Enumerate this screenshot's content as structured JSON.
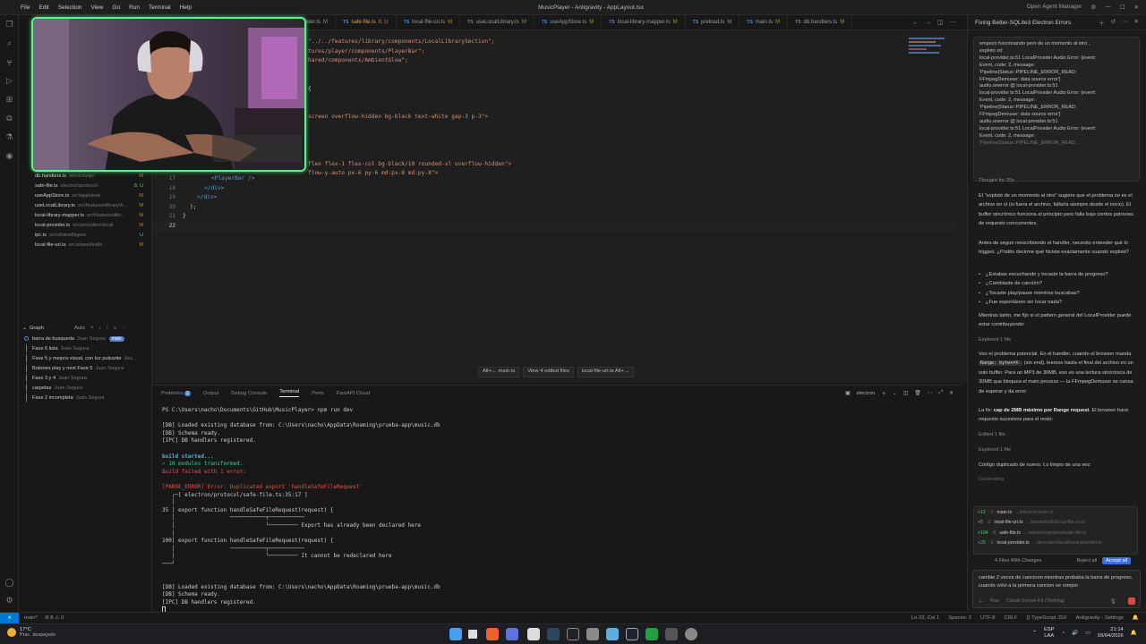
{
  "titlebar": {
    "menu": [
      "File",
      "Edit",
      "Selection",
      "View",
      "Go",
      "Run",
      "Terminal",
      "Help"
    ],
    "title": "MusicPlayer - Antigravity - AppLayout.tsx",
    "agent_manager": "Open Agent Manager"
  },
  "tabs": [
    {
      "label": "ider.ts",
      "mark": "M"
    },
    {
      "label": "safe-file.ts",
      "mark": "8, U"
    },
    {
      "label": "local-file-uri.ts",
      "mark": "M"
    },
    {
      "label": "useLocalLibrary.ts",
      "mark": "M"
    },
    {
      "label": "useAppStore.ts",
      "mark": "M"
    },
    {
      "label": "local-library-mapper.ts",
      "mark": "M"
    },
    {
      "label": "preload.ts",
      "mark": "M"
    },
    {
      "label": "main.ts",
      "mark": "M"
    },
    {
      "label": "db.handlers.ts",
      "mark": "M"
    }
  ],
  "editor": {
    "top_lines": [
      "\"../../features/library/components/LocalLibrarySection\";",
      "tures/player/components/PlayerBar\";",
      "hared/components/AmbientGlow\";",
      "",
      "",
      "{",
      "",
      "",
      "screen overflow-hidden bg-black text-white gap-3 p-3\">",
      "",
      "",
      "",
      "",
      "flex flex-1 flex-col bg-black/10 rounded-xl overflow-hidden\">",
      "flow-y-auto px-6 py-6 md:px-8 md:py-8\">"
    ],
    "bottom_numbers": [
      "17",
      "18",
      "19",
      "20",
      "21",
      "22"
    ],
    "bottom_lines": [
      "<PlayerBar />",
      "</div>",
      "</div>",
      ");",
      "}",
      ""
    ]
  },
  "review_bar": {
    "main": "Alt+← main.ts",
    "view": "View 4 edited files",
    "next": "local-file-uri.ts Alt+→"
  },
  "sidebar": {
    "files": [
      {
        "name": "db.handlers.ts",
        "path": "electron/ipc",
        "status": "M"
      },
      {
        "name": "safe-file.ts",
        "path": "electron\\protocol",
        "status": "8, U"
      },
      {
        "name": "useAppStore.ts",
        "path": "src\\app\\store",
        "status": "M"
      },
      {
        "name": "useLocalLibrary.ts",
        "path": "src\\features\\library\\h...",
        "status": "M"
      },
      {
        "name": "local-library-mapper.ts",
        "path": "src\\features\\libr...",
        "status": "M"
      },
      {
        "name": "local-provider.ts",
        "path": "src\\providers\\local",
        "status": "M"
      },
      {
        "name": "ipc.ts",
        "path": "src\\shared\\types",
        "status": "U"
      },
      {
        "name": "local-file-uri.ts",
        "path": "src\\shared\\utils",
        "status": "M"
      }
    ],
    "graph_title": "Graph",
    "graph_mode": "Auto",
    "commits": [
      {
        "msg": "barra de busqueda",
        "author": "Juan Segura",
        "badge": "main"
      },
      {
        "msg": "Fase 6 lista",
        "author": "Juan Segura"
      },
      {
        "msg": "Fase 5 y mejora visual, con luz pulsante",
        "author": "Jua..."
      },
      {
        "msg": "Botones play y next Fase 5",
        "author": "Juan Segura"
      },
      {
        "msg": "Fase 3 y 4",
        "author": "Juan Segura"
      },
      {
        "msg": "carpetas",
        "author": "Juan Segura"
      },
      {
        "msg": "Fase 2 incompleta",
        "author": "Juan Segura"
      }
    ]
  },
  "panel": {
    "tabs": [
      "Problems",
      "Output",
      "Debug Console",
      "Terminal",
      "Ports",
      "FastAPI Cloud"
    ],
    "problems_count": "2",
    "active_tab": "Terminal",
    "shell": "electron",
    "terminal": [
      "PS C:\\Users\\nacho\\Documents\\GitHub\\MusicPlayer> npm run dev",
      "",
      "[DB] Loaded existing database from: C:\\Users\\nacho\\AppData\\Roaming\\prueba-app\\music.db",
      "[DB] Schema ready.",
      "[IPC] DB handlers registered.",
      "",
      "build started...",
      "✓ 10 modules transformed.",
      "Build failed with 1 error:",
      "",
      "[PARSE_ERROR] Error: Duplicated export 'handleSafeFileRequest'",
      "   ╭─[ electron/protocol/safe-file.ts:35:17 ]",
      "   │",
      "35 │ export function handleSafeFileRequest(request) {",
      "   │                 ───────────┬───────────",
      "   │                            ╰───────── Export has already been declared here",
      "   │",
      "100│ export function handleSafeFileRequest(request) {",
      "   │                 ───────────┬───────────",
      "   │                            ╰───────── It cannot be redeclared here",
      "───╯",
      "",
      "",
      "[DB] Loaded existing database from: C:\\Users\\nacho\\AppData\\Roaming\\prueba-app\\music.db",
      "[DB] Schema ready.",
      "[IPC] DB handlers registered."
    ]
  },
  "agent": {
    "title": "Fixing Better-SQLite3 Electron Errors",
    "quote_lines": [
      "empezo funcionando pero de un momento al otro ,",
      "exploto xd:",
      "local-provider.ts:51 LocalProvider Audio Error: {event:",
      "Event, code: 2, message:",
      "'Pipeline|Status::PIPELINE_ERROR_READ:",
      "FFmpegDemuxer: data source error'}",
      "audio.onerror @ local-provider.ts:51",
      "local-provider.ts:51 LocalProvider Audio Error: {event:",
      "Event, code: 2, message:",
      "'Pipeline|Status::PIPELINE_ERROR_READ:",
      "FFmpegDemuxer: data source error'}",
      "audio.onerror @ local-provider.ts:51",
      "local-provider.ts:51 LocalProvider Audio Error: {event:",
      "Event, code: 2, message:",
      "'Pipeline|Status::PIPELINE_ERROR_READ..."
    ],
    "thought": "Thought for 26s",
    "para1": "El \"explotó de un momento al otro\" sugiere que el problema no es el archivo en sí (si fuera el archivo, fallaría siempre desde el inicio). El buffer sincrónico funciona al principio pero falla bajo ciertos patrones de requests concurrentes.",
    "para2": "Antes de seguir reescribiendo el handler, necesito entender qué lo triggeó. ¿Podés decirme qué hiciste exactamente cuando explotó?",
    "bullets": [
      "¿Estabas escuchando y tocaste la barra de progreso?",
      "¿Cambiaste de canción?",
      "¿Tocaste play/pause mientras buscabas?",
      "¿Fue espontáneo sin tocar nada?"
    ],
    "para3": "Mientras tanto, me fijo si el pattern general del LocalProvider puede estar contribuyendo:",
    "explored1": "Explored 1 file",
    "para4a": "Veo el problema potencial. En el handler, cuando el browser manda",
    "chip": "Range: bytes=X-",
    "para4b": "(sin end), leemos hasta el final del archivo en un solo buffer. Para un MP3 de 30MB, eso es una lectura sincrónica de 30MB que bloquea el main process — la FFmpegDemuxer se cansa de esperar y da error.",
    "para5a": "La fix:",
    "para5b": "cap de 2MB máximo por Range request",
    "para5c": ". El browser hace requests sucesivos para el resto:",
    "edited": "Edited 1 file",
    "explored2": "Explored 1 file",
    "para6": "Código duplicado de nuevo. Lo limpio de una vez:",
    "generating": "Generating",
    "changes": [
      {
        "add": "+12",
        "del": "-7",
        "file": "main.ts",
        "path": "...\\electron\\main.ts"
      },
      {
        "add": "+5",
        "del": "-1",
        "file": "local-file-uri.ts",
        "path": "...\\shared\\utils\\local-file-uri.ts"
      },
      {
        "add": "+104",
        "del": "-0",
        "file": "safe-file.ts",
        "path": "...\\electron\\protocol\\safe-file.ts"
      },
      {
        "add": "+25",
        "del": "-1",
        "file": "local-provider.ts",
        "path": "...\\providers\\local\\local-provider.ts"
      }
    ],
    "files_with_changes": "4 Files With Changes",
    "reject_all": "Reject all",
    "accept_all": "Accept all",
    "input_text": "cambie 2 veces de cancioon mientras probaba la barra de progreso, cuando volvi a la primera cancion se rompio",
    "plan_label": "Plan",
    "model_label": "Claude Sonnet 4.6 (Thinking)"
  },
  "statusbar": {
    "branch": "main*",
    "problems": "⊘ 8 ⚠ 0",
    "position": "Ln 22, Col 1",
    "spaces": "Spaces: 2",
    "encoding": "UTF-8",
    "eol": "CRLF",
    "language": "{} TypeScript JSX",
    "settings": "Antigravity - Settings"
  },
  "taskbar": {
    "temp": "17°C",
    "weather": "Prac. despejado",
    "lang1": "ESP",
    "lang2": "LAA",
    "time": "21:14",
    "date": "09/04/2026"
  }
}
